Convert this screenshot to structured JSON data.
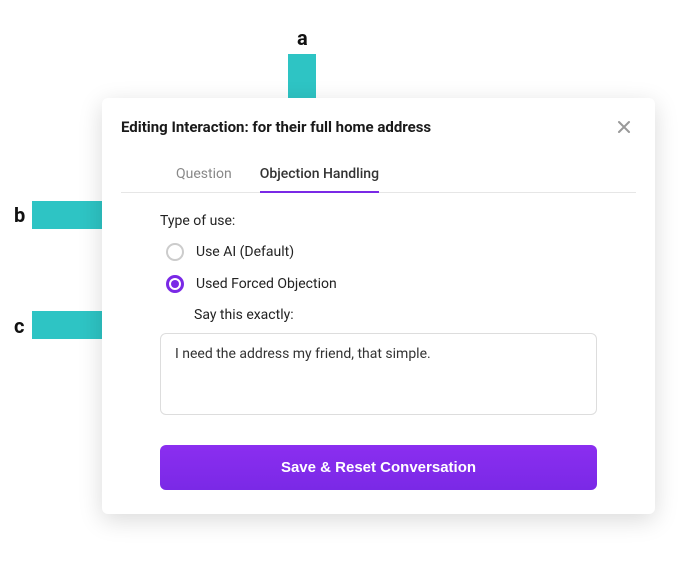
{
  "callouts": {
    "a": "a",
    "b": "b",
    "c": "c"
  },
  "modal": {
    "title": "Editing Interaction: for their full home address",
    "tabs": {
      "question": "Question",
      "objection": "Objection Handling",
      "active": "objection"
    },
    "type_of_use_label": "Type of use:",
    "options": {
      "use_ai": "Use AI (Default)",
      "forced": "Used Forced Objection",
      "selected": "forced"
    },
    "say_exactly_label": "Say this exactly:",
    "say_exactly_value": "I need the address my friend, that simple.",
    "save_label": "Save & Reset Conversation"
  }
}
